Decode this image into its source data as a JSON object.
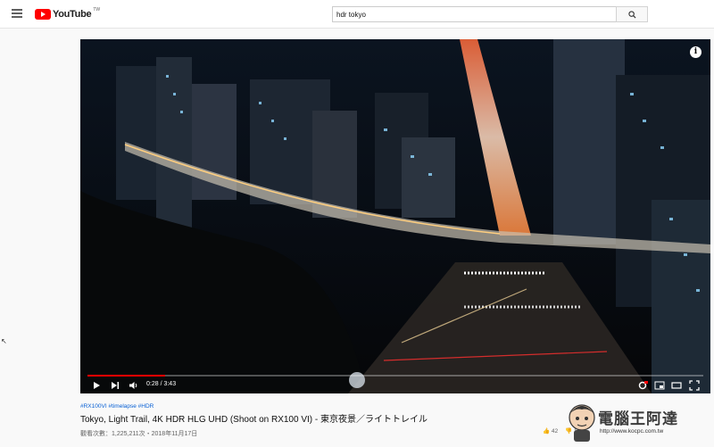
{
  "header": {
    "logo_text": "YouTube",
    "logo_tw": "TW",
    "search_value": "hdr tokyo"
  },
  "player": {
    "time": "0:28 / 3:43",
    "progress_fraction": 0.126,
    "info_glyph": "i"
  },
  "video": {
    "tags": "#RX100VI #timelapse #HDR",
    "title": "Tokyo, Light Trail, 4K HDR HLG UHD (Shoot on RX100 VI) - 東京夜景／ライトトレイル",
    "meta": "觀看次數：1,225,211次・2018年11月17日",
    "likes": "42",
    "dislikes": "153"
  },
  "watermark": {
    "text": "電腦王阿達",
    "url": "http://www.kocpc.com.tw"
  },
  "colors": {
    "brand": "#ff0000",
    "progress": "#ff0000",
    "link": "#065fd4"
  }
}
